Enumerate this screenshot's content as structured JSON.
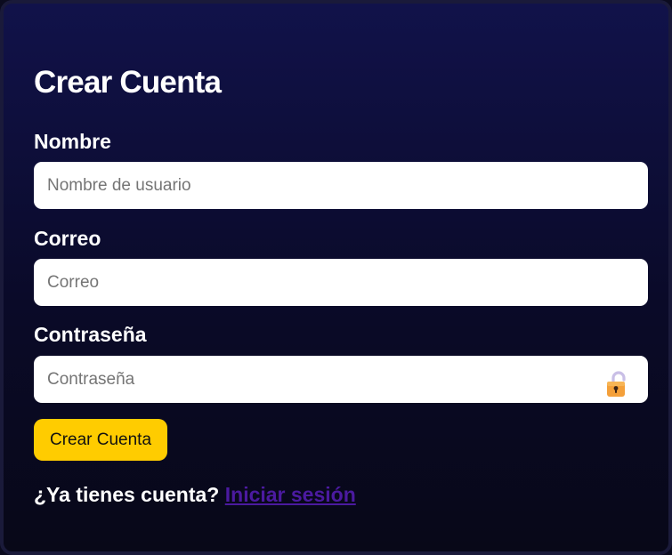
{
  "form": {
    "title": "Crear Cuenta",
    "fields": [
      {
        "label": "Nombre",
        "placeholder": "Nombre de usuario",
        "value": ""
      },
      {
        "label": "Correo",
        "placeholder": "Correo",
        "value": ""
      },
      {
        "label": "Contraseña",
        "placeholder": "Contraseña",
        "value": "",
        "icon": "lock-icon"
      }
    ],
    "submit_label": "Crear Cuenta",
    "footer": {
      "prompt": "¿Ya tienes cuenta?",
      "link": "Iniciar sesión"
    }
  },
  "colors": {
    "background": "#0a0a28",
    "accent": "#ffcc00",
    "link": "#4b1aa0",
    "text": "#ffffff"
  }
}
